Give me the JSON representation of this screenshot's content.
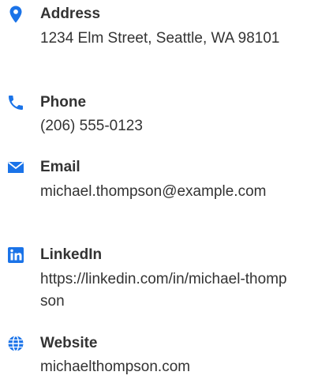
{
  "contact": {
    "items": [
      {
        "key": "address",
        "icon": "location-pin-icon",
        "label": "Address",
        "value": "1234 Elm Street, Seattle, WA 98101"
      },
      {
        "key": "phone",
        "icon": "phone-icon",
        "label": "Phone",
        "value": "(206) 555-0123"
      },
      {
        "key": "email",
        "icon": "envelope-icon",
        "label": "Email",
        "value": "michael.thompson@example.com"
      },
      {
        "key": "linkedin",
        "icon": "linkedin-icon",
        "label": "LinkedIn",
        "value": "https://linkedin.com/in/michael-thompson"
      },
      {
        "key": "website",
        "icon": "globe-icon",
        "label": "Website",
        "value": "michaelthompson.com"
      }
    ],
    "icon_color": "#1a73e8"
  }
}
